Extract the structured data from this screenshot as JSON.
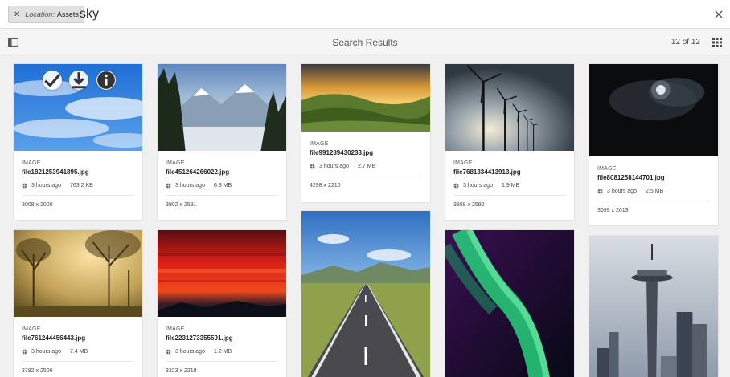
{
  "search": {
    "tag_key": "Location:",
    "tag_value": "Assets",
    "query": "sky"
  },
  "toolbar": {
    "title": "Search Results",
    "count": "12 of 12"
  },
  "assets": [
    {
      "type": "IMAGE",
      "name": "file1821253941895.jpg",
      "modified": "3 hours ago",
      "size": "763.2 KB",
      "dims": "3008 x 2000"
    },
    {
      "type": "IMAGE",
      "name": "file451264266022.jpg",
      "modified": "3 hours ago",
      "size": "6.3 MB",
      "dims": "3902 x 2591"
    },
    {
      "type": "IMAGE",
      "name": "file991289430233.jpg",
      "modified": "3 hours ago",
      "size": "2.7 MB",
      "dims": "4298 x 2210"
    },
    {
      "type": "IMAGE",
      "name": "file7681334413913.jpg",
      "modified": "3 hours ago",
      "size": "1.9 MB",
      "dims": "3888 x 2592"
    },
    {
      "type": "IMAGE",
      "name": "file8081258144701.jpg",
      "modified": "3 hours ago",
      "size": "2.5 MB",
      "dims": "3699 x 2613"
    },
    {
      "type": "IMAGE",
      "name": "file761244456443.jpg",
      "modified": "3 hours ago",
      "size": "7.4 MB",
      "dims": "3782 x 2506"
    },
    {
      "type": "IMAGE",
      "name": "file2231273355591.jpg",
      "modified": "3 hours ago",
      "size": "1.2 MB",
      "dims": "3323 x 2218"
    }
  ],
  "icons": {
    "tag_remove": "close-icon",
    "clear_search": "close-icon",
    "rail": "rail-toggle-icon",
    "view": "grid-view-icon",
    "select": "checkmark-icon",
    "download": "download-icon",
    "properties": "info-icon",
    "location": "globe-icon"
  }
}
